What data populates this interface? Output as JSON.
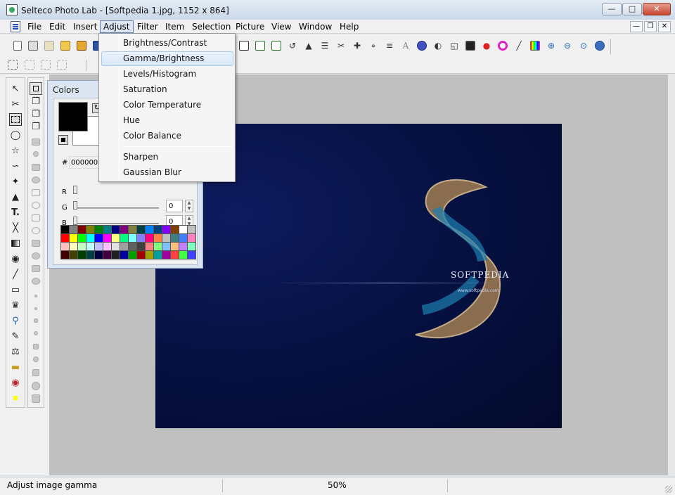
{
  "window": {
    "title": "Selteco Photo Lab - [Softpedia 1.jpg, 1152 x 864]",
    "minimize_icon": "minimize-icon",
    "maximize_icon": "maximize-icon",
    "close_icon": "close-icon"
  },
  "menu": {
    "items": [
      "File",
      "Edit",
      "Insert",
      "Adjust",
      "Filter",
      "Item",
      "Selection",
      "Picture",
      "View",
      "Window",
      "Help"
    ],
    "active": "Adjust"
  },
  "adjust_menu": {
    "items": [
      "Brightness/Contrast",
      "Gamma/Brightness",
      "Levels/Histogram",
      "Saturation",
      "Color Temperature",
      "Hue",
      "Color Balance",
      "Sharpen",
      "Gaussian Blur"
    ],
    "highlighted": "Gamma/Brightness"
  },
  "colors_panel": {
    "title": "Colors",
    "hex_label": "#",
    "hex_value": "000000",
    "r_label": "R",
    "g_label": "G",
    "b_label": "B",
    "g_value": "0",
    "b_value": "0",
    "palette": [
      "#000000",
      "#808080",
      "#800000",
      "#808000",
      "#008000",
      "#008080",
      "#000080",
      "#800080",
      "#808040",
      "#004040",
      "#0080ff",
      "#004080",
      "#8000ff",
      "#804000",
      "#ffffff",
      "#c0c0c0",
      "#ff0000",
      "#ffff00",
      "#00ff00",
      "#00ffff",
      "#0000ff",
      "#ff00ff",
      "#ffff80",
      "#00ff80",
      "#80ffff",
      "#8080ff",
      "#ff0080",
      "#ff8040",
      "#c0c0c0",
      "#408080",
      "#4080ff",
      "#ff80c0",
      "#ffc0c0",
      "#ffffc0",
      "#c0ffc0",
      "#c0ffff",
      "#c0c0ff",
      "#ffc0ff",
      "#e0e0e0",
      "#a0a0a0",
      "#606060",
      "#404040",
      "#ff8080",
      "#80ff80",
      "#80c0ff",
      "#ffc080",
      "#c080ff",
      "#80ffc0",
      "#400000",
      "#404000",
      "#004000",
      "#004040",
      "#000040",
      "#400040",
      "#202020",
      "#0000a0",
      "#00a000",
      "#a00000",
      "#a0a000",
      "#00a0a0",
      "#a000a0",
      "#ff4040",
      "#40ff40",
      "#4040ff"
    ]
  },
  "image": {
    "watermark_title": "SOFTPEDIA",
    "watermark_url": "www.softpedia.com"
  },
  "status": {
    "message": "Adjust image gamma",
    "zoom": "50%"
  }
}
